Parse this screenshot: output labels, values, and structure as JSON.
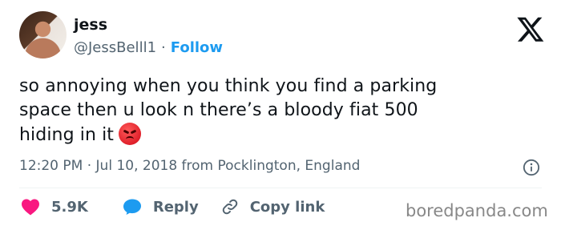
{
  "author": {
    "name": "jess",
    "handle": "@JessBelll1",
    "separator": "·",
    "follow_label": "Follow"
  },
  "tweet": {
    "lines": [
      "so annoying when you think you find a parking",
      "space then u look n there’s a bloody fiat 500",
      "hiding in it"
    ],
    "emoji": "angry-face-emoji"
  },
  "meta": {
    "text": "12:20 PM · Jul 10, 2018 from Pocklington, England"
  },
  "actions": {
    "likes": "5.9K",
    "reply_label": "Reply",
    "copy_label": "Copy link"
  },
  "watermark": "boredpanda.com",
  "colors": {
    "accent": "#1d9bf0",
    "like": "#f91880",
    "muted": "#536471"
  }
}
